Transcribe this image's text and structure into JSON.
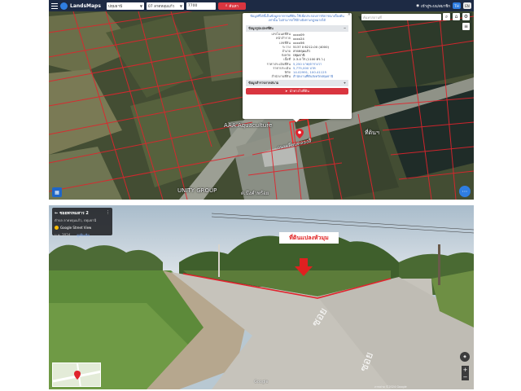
{
  "topbar": {
    "brand": "LandsMaps",
    "province_select": "ปทุมธานี",
    "district_select": "07 ลาดหลุมแก้ว",
    "parcel_input": "7700",
    "search_button": "ค้นหา",
    "user_label": "เข้าสู่ระบบ/สมาชิก",
    "lang_th": "TH",
    "lang_en": "EN"
  },
  "map": {
    "search_placeholder": "ค้นหาสถานที่",
    "labels": {
      "road": "ถนนเลียบคลองสี่",
      "aquaculture": "AAA Aquaculture",
      "unity": "UNITY GROUP",
      "area_right": "ที่ดินฯ",
      "bottom_left": "ต.บึงคำพร้อย"
    },
    "popup": {
      "notice": "ข้อมูลที่ได้นี้เป็นข้อมูลจากกรมที่ดิน ใช้เพื่อประกอบการพิจารณาเบื้องต้นเท่านั้น ไม่สามารถใช้อ้างอิงทางกฎหมายได้",
      "section1": "ข้อมูลรูปแปลงที่ดิน",
      "rows": [
        {
          "k": "เลขโฉนดที่ดิน",
          "v": "xxxx09"
        },
        {
          "k": "หน้าสำรวจ",
          "v": "xxxx24"
        },
        {
          "k": "เลขที่ดิน",
          "v": "xxxx56"
        },
        {
          "k": "ระวาง",
          "v": "5137 II 6212-00 (4000)"
        },
        {
          "k": "อำเภอ",
          "v": "ลาดหลุมแก้ว"
        },
        {
          "k": "จังหวัด",
          "v": "ปทุมธานี"
        },
        {
          "k": "เนื้อที่",
          "v": "2-3-0 ไร่ (1100 ตร.ว.)"
        },
        {
          "k": "ราคาประเมินที่ดิน",
          "v": "5,250 บาท/ตารางวา"
        },
        {
          "k": "ราคาประเมิน",
          "v": "5,775,000 บาท"
        },
        {
          "k": "พิกัด",
          "v": "14.02991, 100.41125"
        },
        {
          "k": "สำนักงานที่ดิน",
          "v": "สำนักงานที่ดินจังหวัดปทุมธานี"
        }
      ],
      "section2": "ข้อมูลสำรวจภาคสนาม",
      "button": "นำทางไปที่ดิน"
    }
  },
  "street": {
    "info_title": "ซอยพรหมสาร 2",
    "info_sub": "ตำบล ลาดหลุมแก้ว, ปทุมธานี",
    "gsv": "Google Street View",
    "date": "ม.ค. 2024",
    "more": "ดูเพิ่มเติม",
    "land_label": "ที่ดินแปลงหัวมุม",
    "google": "Google",
    "footer": "ภาพถ่าย ©2024 Google"
  }
}
